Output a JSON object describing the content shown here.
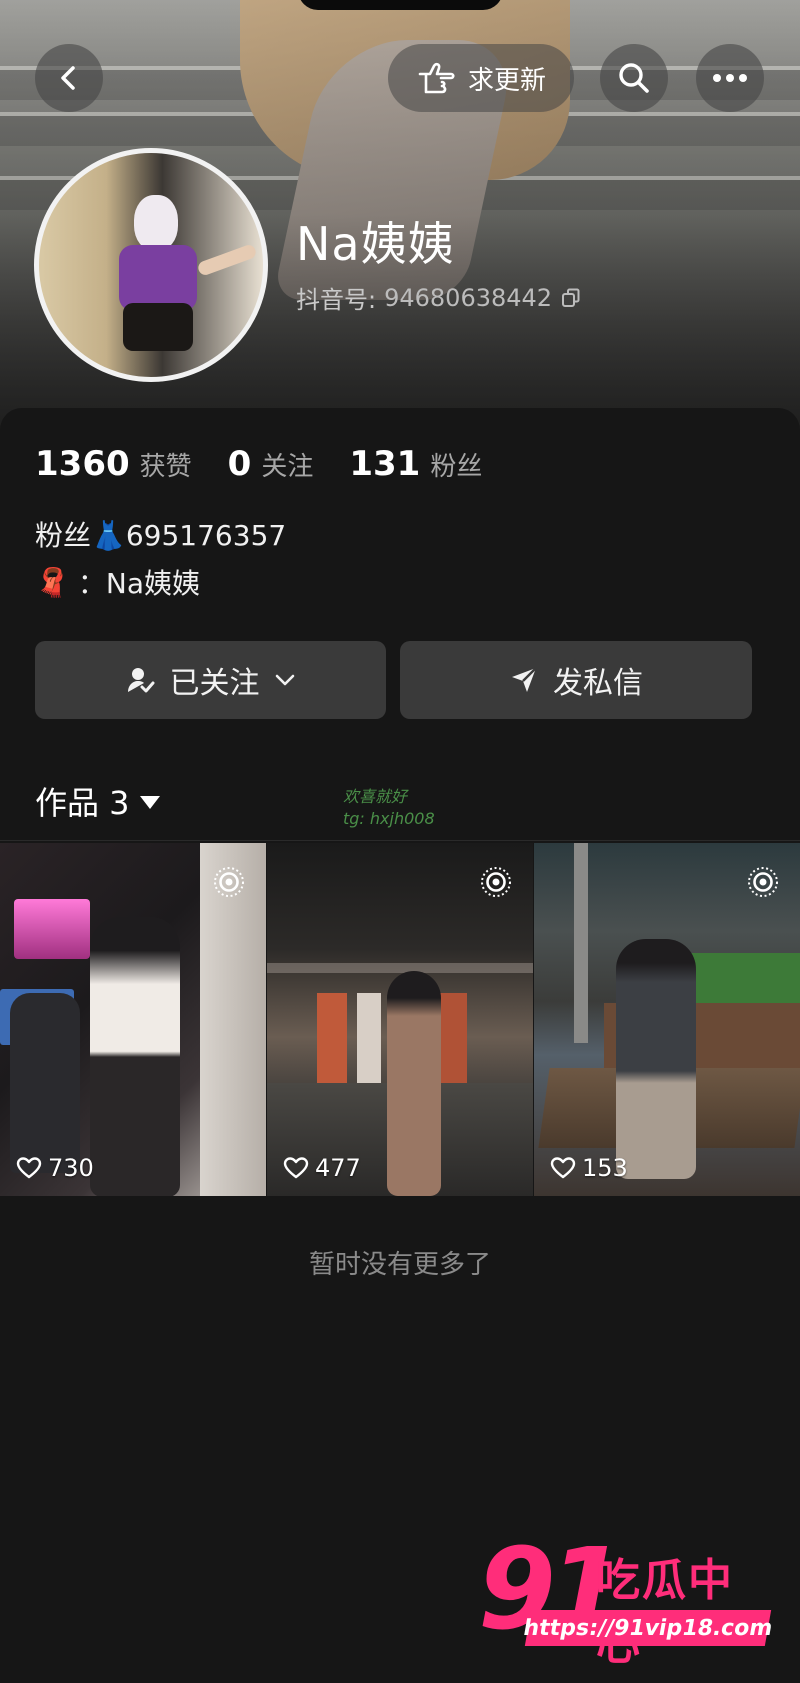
{
  "header": {
    "request_update_label": "求更新"
  },
  "profile": {
    "name": "Na姨姨",
    "douyin_id_label": "抖音号:",
    "douyin_id": "94680638442"
  },
  "stats": [
    {
      "value": "1360",
      "label": "获赞"
    },
    {
      "value": "0",
      "label": "关注"
    },
    {
      "value": "131",
      "label": "粉丝"
    }
  ],
  "bio": {
    "line1": "粉丝👗695176357",
    "line2_emoji": "🧣",
    "line2_text": "：Na姨姨"
  },
  "actions": {
    "followed_label": "已关注",
    "message_label": "发私信"
  },
  "works": {
    "tab_label": "作品 3",
    "watermark_line1": "欢喜就好",
    "watermark_line2": "tg: hxjh008",
    "items": [
      {
        "likes": "730"
      },
      {
        "likes": "477"
      },
      {
        "likes": "153"
      }
    ],
    "end_text": "暂时没有更多了"
  },
  "logo": {
    "big": "91",
    "cn": "吃瓜中心",
    "url": "https://91vip18.com"
  },
  "colors": {
    "background": "#161616",
    "button": "#3a3a3a",
    "logo_accent": "#ff2d7a"
  }
}
